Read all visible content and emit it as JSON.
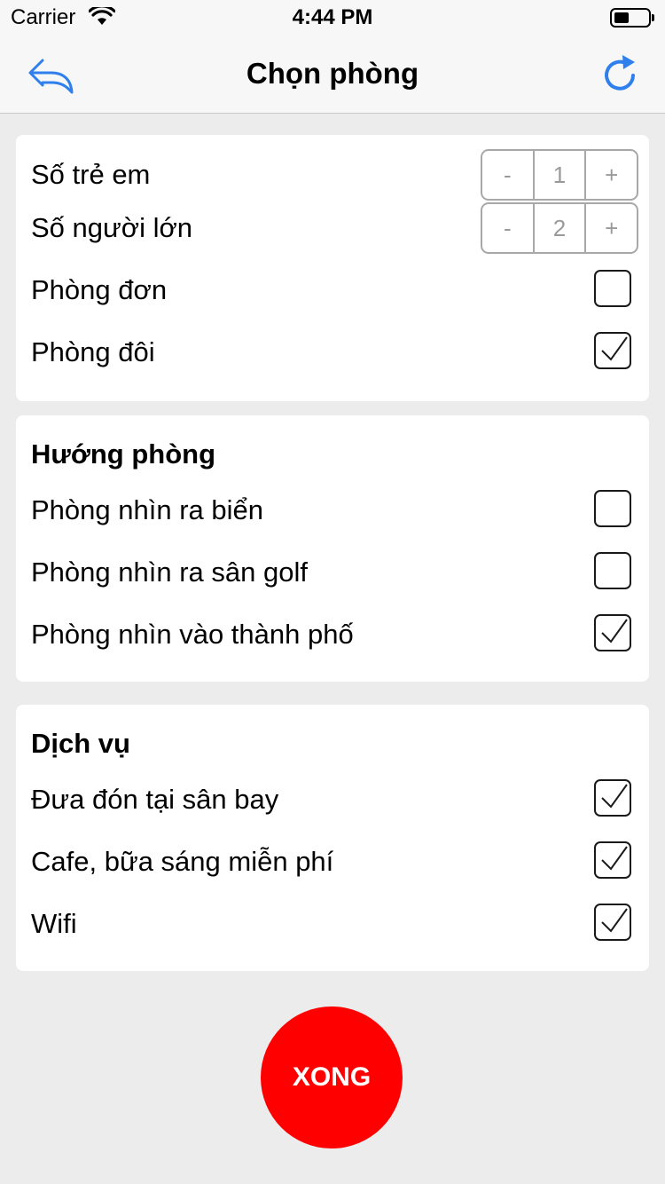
{
  "status_bar": {
    "carrier": "Carrier",
    "time": "4:44 PM",
    "wifi_icon": "wifi-icon",
    "battery_icon": "battery-icon"
  },
  "navbar": {
    "title": "Chọn phòng",
    "back_icon": "reply-back-icon",
    "refresh_icon": "refresh-icon",
    "accent_color": "#2f80ed"
  },
  "room_card": {
    "children_label": "Số trẻ em",
    "children_stepper": {
      "minus": "-",
      "value": "1",
      "plus": "+"
    },
    "adults_label": "Số người lớn",
    "adults_stepper": {
      "minus": "-",
      "value": "2",
      "plus": "+"
    },
    "single_room": {
      "label": "Phòng đơn",
      "checked": false
    },
    "double_room": {
      "label": "Phòng đôi",
      "checked": true
    }
  },
  "view_card": {
    "title": "Hướng phòng",
    "items": [
      {
        "label": "Phòng nhìn ra biển",
        "checked": false
      },
      {
        "label": "Phòng nhìn ra sân golf",
        "checked": false
      },
      {
        "label": "Phòng nhìn vào thành phố",
        "checked": true
      }
    ]
  },
  "service_card": {
    "title": "Dịch vụ",
    "items": [
      {
        "label": "Đưa đón tại sân bay",
        "checked": true
      },
      {
        "label": "Cafe, bữa sáng miễn phí",
        "checked": true
      },
      {
        "label": "Wifi",
        "checked": true
      }
    ]
  },
  "done_button": {
    "label": "XONG",
    "color": "#ff0000"
  }
}
